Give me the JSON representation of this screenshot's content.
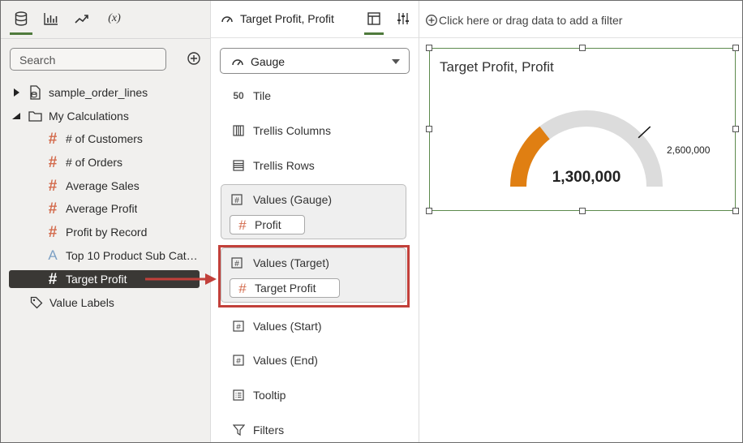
{
  "data_panel": {
    "tabs": [
      {
        "name": "database-icon",
        "active": true
      },
      {
        "name": "bar-chart-icon",
        "active": false
      },
      {
        "name": "trend-icon",
        "active": false
      },
      {
        "name": "(x)",
        "active": false
      }
    ],
    "search_placeholder": "Search",
    "tree": {
      "dataset": "sample_order_lines",
      "folder": "My Calculations",
      "items": [
        "# of Customers",
        "# of Orders",
        "Average Sales",
        "Average Profit",
        "Profit by Record"
      ],
      "attribute_item": "Top 10 Product Sub Cat…",
      "selected_item": "Target Profit",
      "value_labels": "Value Labels"
    }
  },
  "grammar_panel": {
    "title": "Target Profit, Profit",
    "viz_type": "Gauge",
    "tile": "Tile",
    "tile_icon_text": "50",
    "trellis_columns": "Trellis Columns",
    "trellis_rows": "Trellis Rows",
    "values_gauge": {
      "title": "Values (Gauge)",
      "chip": "Profit"
    },
    "values_target": {
      "title": "Values (Target)",
      "chip": "Target Profit"
    },
    "values_start": "Values (Start)",
    "values_end": "Values (End)",
    "tooltip": "Tooltip",
    "filters": "Filters"
  },
  "canvas": {
    "filter_prompt": "Click here or drag data to add a filter",
    "viz_title": "Target Profit, Profit",
    "accent_color": "#e07f12",
    "track_color": "#dcdcdc",
    "selection_color": "#5d8a4d"
  },
  "chart_data": {
    "type": "gauge",
    "title": "Target Profit, Profit",
    "value": 1300000,
    "value_label": "1,300,000",
    "target": 2600000,
    "target_label": "2,600,000",
    "fill_fraction": 0.29
  }
}
